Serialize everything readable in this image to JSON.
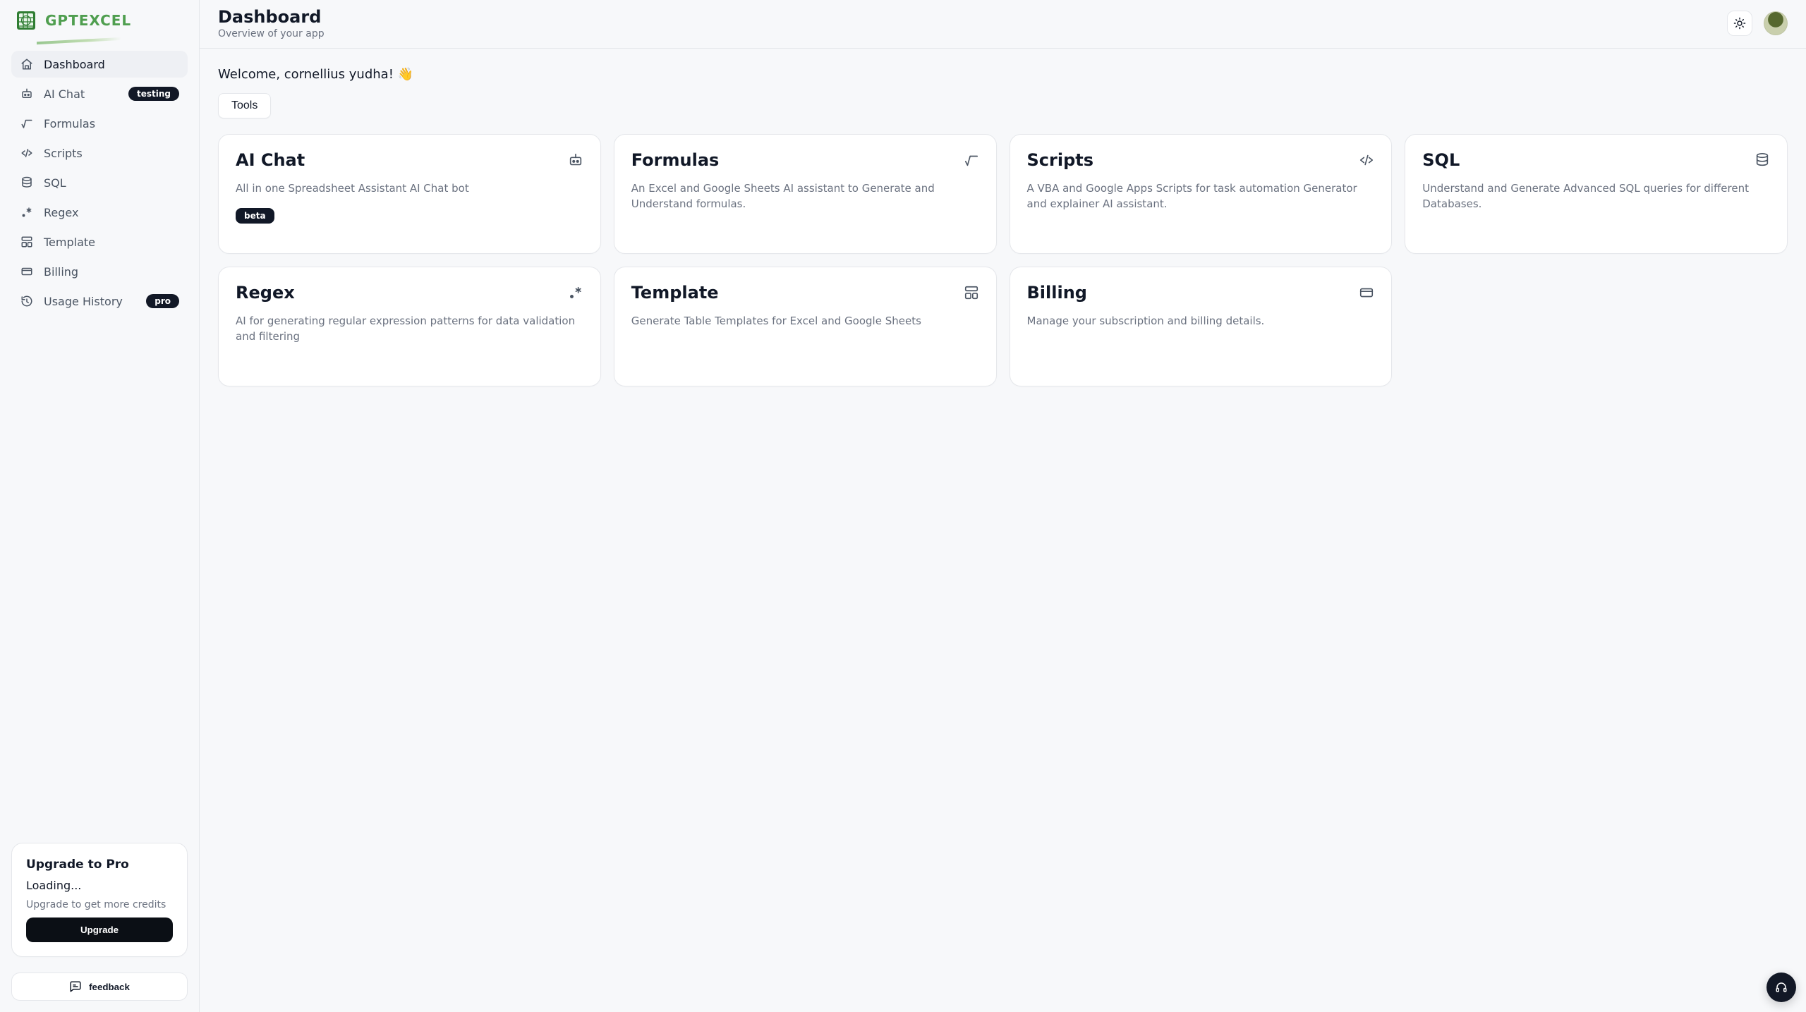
{
  "brand": {
    "name": "GPTEXCEL"
  },
  "sidebar": {
    "items": [
      {
        "label": "Dashboard",
        "badge": ""
      },
      {
        "label": "AI Chat",
        "badge": "testing"
      },
      {
        "label": "Formulas",
        "badge": ""
      },
      {
        "label": "Scripts",
        "badge": ""
      },
      {
        "label": "SQL",
        "badge": ""
      },
      {
        "label": "Regex",
        "badge": ""
      },
      {
        "label": "Template",
        "badge": ""
      },
      {
        "label": "Billing",
        "badge": ""
      },
      {
        "label": "Usage History",
        "badge": "pro"
      }
    ],
    "upgrade": {
      "title": "Upgrade to Pro",
      "loading": "Loading...",
      "sub": "Upgrade to get more credits",
      "cta": "Upgrade"
    },
    "feedback_label": "feedback"
  },
  "header": {
    "title": "Dashboard",
    "subtitle": "Overview of your app"
  },
  "main": {
    "welcome": "Welcome, cornellius yudha! 👋",
    "tools_label": "Tools",
    "cards": [
      {
        "title": "AI Chat",
        "desc": "All in one Spreadsheet Assistant AI Chat bot",
        "badge": "beta"
      },
      {
        "title": "Formulas",
        "desc": "An Excel and Google Sheets AI assistant to Generate and Understand formulas."
      },
      {
        "title": "Scripts",
        "desc": "A VBA and Google Apps Scripts for task automation Generator and explainer AI assistant."
      },
      {
        "title": "SQL",
        "desc": "Understand and Generate Advanced SQL queries for different Databases."
      },
      {
        "title": "Regex",
        "desc": "AI for generating regular expression patterns for data validation and filtering"
      },
      {
        "title": "Template",
        "desc": "Generate Table Templates for Excel and Google Sheets"
      },
      {
        "title": "Billing",
        "desc": "Manage your subscription and billing details."
      }
    ]
  }
}
